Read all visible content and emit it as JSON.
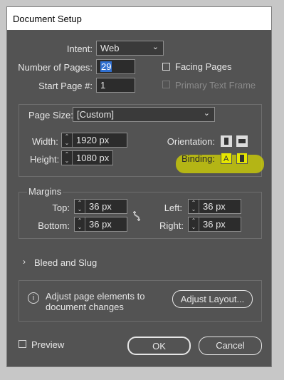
{
  "dialog": {
    "title": "Document Setup"
  },
  "intent": {
    "label": "Intent:",
    "value": "Web"
  },
  "pages": {
    "label": "Number of Pages:",
    "value": "29"
  },
  "start_page": {
    "label": "Start Page #:",
    "value": "1"
  },
  "facing_pages": {
    "label": "Facing Pages",
    "checked": false
  },
  "primary_text_frame": {
    "label": "Primary Text Frame",
    "checked": false,
    "enabled": false
  },
  "page_size": {
    "label": "Page Size:",
    "value": "[Custom]"
  },
  "width": {
    "label": "Width:",
    "value": "1920 px"
  },
  "height": {
    "label": "Height:",
    "value": "1080 px"
  },
  "orientation": {
    "label": "Orientation:"
  },
  "binding": {
    "label": "Binding:"
  },
  "margins": {
    "label": "Margins",
    "top": {
      "label": "Top:",
      "value": "36 px"
    },
    "bottom": {
      "label": "Bottom:",
      "value": "36 px"
    },
    "left": {
      "label": "Left:",
      "value": "36 px"
    },
    "right": {
      "label": "Right:",
      "value": "36 px"
    }
  },
  "bleed": {
    "label": "Bleed and Slug"
  },
  "info": {
    "text_line1": "Adjust page elements to",
    "text_line2": "document changes",
    "button": "Adjust Layout..."
  },
  "preview": {
    "label": "Preview",
    "checked": false
  },
  "buttons": {
    "ok": "OK",
    "cancel": "Cancel"
  },
  "colors": {
    "dialog_bg": "#535353",
    "highlight": "#d4d600",
    "field_bg": "#2c2c2c"
  }
}
